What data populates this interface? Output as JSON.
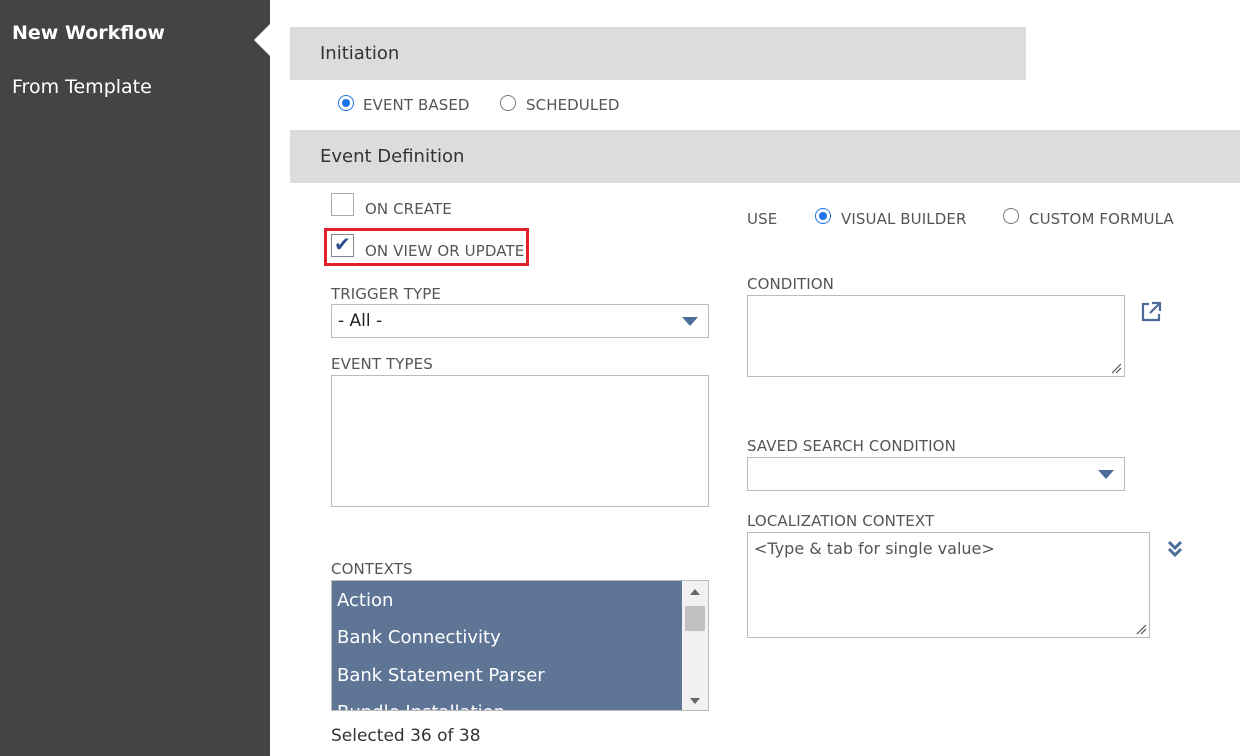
{
  "sidebar": {
    "items": [
      {
        "label": "New Workflow",
        "active": true
      },
      {
        "label": "From Template",
        "active": false
      }
    ]
  },
  "initiation": {
    "title": "Initiation",
    "options": [
      {
        "label": "EVENT BASED",
        "selected": true
      },
      {
        "label": "SCHEDULED",
        "selected": false
      }
    ]
  },
  "event_definition": {
    "title": "Event Definition",
    "on_create": {
      "label": "ON CREATE",
      "checked": false
    },
    "on_view_or_update": {
      "label": "ON VIEW OR UPDATE",
      "checked": true
    },
    "use": {
      "label": "USE",
      "options": [
        {
          "label": "VISUAL BUILDER",
          "selected": true
        },
        {
          "label": "CUSTOM FORMULA",
          "selected": false
        }
      ]
    },
    "trigger_type": {
      "label": "TRIGGER TYPE",
      "value": "- All -"
    },
    "condition": {
      "label": "CONDITION",
      "value": ""
    },
    "event_types": {
      "label": "EVENT TYPES"
    },
    "saved_search_condition": {
      "label": "SAVED SEARCH CONDITION",
      "value": ""
    },
    "localization_context": {
      "label": "LOCALIZATION CONTEXT",
      "placeholder": "<Type & tab for single value>"
    },
    "contexts": {
      "label": "CONTEXTS",
      "items": [
        "Action",
        "Bank Connectivity",
        "Bank Statement Parser",
        "Bundle Installation"
      ],
      "selected_text": "Selected 36 of 38"
    }
  },
  "colors": {
    "sidebar_bg": "#444444",
    "header_bg": "#dcdcdc",
    "accent_blue": "#1a73e8",
    "list_selected_bg": "#5f7596",
    "highlight_red": "#e0202a"
  }
}
